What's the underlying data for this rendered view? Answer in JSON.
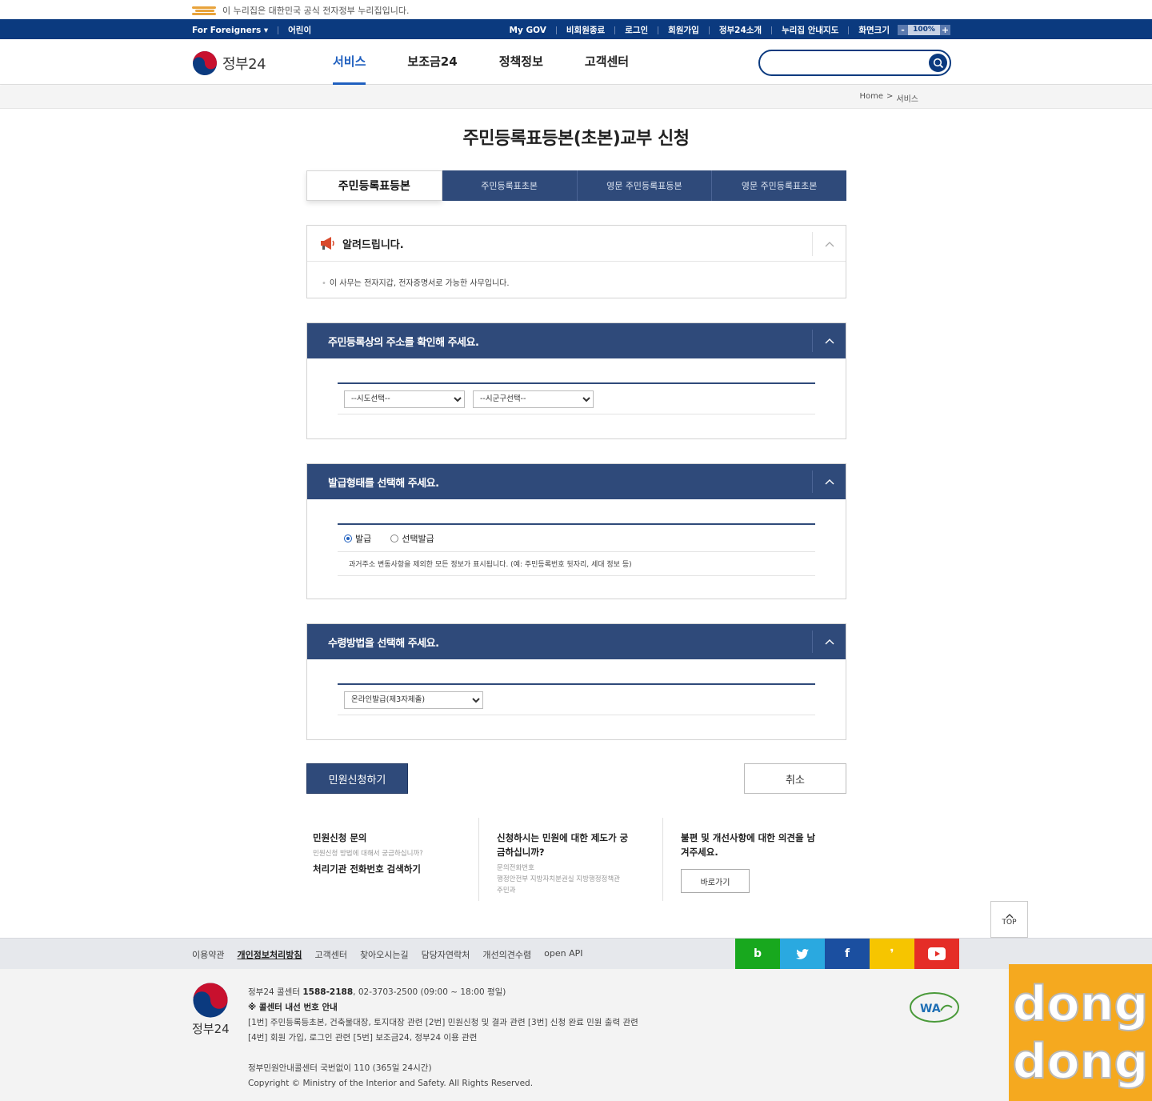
{
  "banner": {
    "text": "이 누리집은 대한민국 공식 전자정부 누리집입니다."
  },
  "util": {
    "left": [
      "For Foreigners ▾",
      "어린이"
    ],
    "right": [
      "My GOV",
      "비회원종료",
      "로그인",
      "회원가입",
      "정부24소개",
      "누리집 안내지도",
      "화면크기"
    ],
    "zoom_minus": "-",
    "zoom_value": "100%",
    "zoom_plus": "+"
  },
  "header": {
    "logo_text": "정부24",
    "nav": [
      "서비스",
      "보조금24",
      "정책정보",
      "고객센터"
    ],
    "search_placeholder": ""
  },
  "breadcrumb": [
    "Home",
    ">",
    "서비스"
  ],
  "page_title": "주민등록표등본(초본)교부 신청",
  "tabs": [
    "주민등록표등본",
    "주민등록표초본",
    "영문 주민등록표등본",
    "영문 주민등록표초본"
  ],
  "notice": {
    "title": "알려드립니다.",
    "body": "이 사무는 전자지갑, 전자증명서로 가능한 사무입니다."
  },
  "sections": {
    "address": {
      "title": "주민등록상의 주소를 확인해 주세요.",
      "sido": "--시도선택--",
      "sigungu": "--시군구선택--"
    },
    "issue": {
      "title": "발급형태를 선택해 주세요.",
      "options": [
        "발급",
        "선택발급"
      ],
      "desc": "과거주소 변동사항을 제외한 모든 정보가 표시됩니다. (예: 주민등록번호 뒷자리, 세대 정보 등)"
    },
    "receive": {
      "title": "수령방법을 선택해 주세요.",
      "method": "온라인발급(제3자제출)"
    }
  },
  "buttons": {
    "submit": "민원신청하기",
    "cancel": "취소"
  },
  "info": {
    "col1": {
      "title": "민원신청 문의",
      "sub": "민원신청 방법에 대해서 궁금하십니까?",
      "link": "처리기관 전화번호 검색하기"
    },
    "col2": {
      "title1": "신청하시는 민원에 대한 제도가 궁",
      "title2": "금하십니까?",
      "sub1": "문의전화번호",
      "sub2": "행정안전부 지방자치분권실 지방행정정책관",
      "sub3": "주민과"
    },
    "col3": {
      "title1": "불편 및 개선사항에 대한 의견을 남",
      "title2": "겨주세요.",
      "button": "바로가기"
    }
  },
  "top_button": "TOP",
  "footer_links": [
    "이용약관",
    "개인정보처리방침",
    "고객센터",
    "찾아오시는길",
    "담당자연락처",
    "개선의견수렴",
    "open API"
  ],
  "sns": [
    {
      "name": "blog",
      "glyph": "b",
      "color": "#18a81e"
    },
    {
      "name": "twitter",
      "glyph": "🐦",
      "color": "#2aa9e0"
    },
    {
      "name": "facebook",
      "glyph": "f",
      "color": "#1b4fa0"
    },
    {
      "name": "kakao",
      "glyph": "❜",
      "color": "#f6c500"
    },
    {
      "name": "youtube",
      "glyph": "▶",
      "color": "#e52d27"
    }
  ],
  "footer": {
    "logo_text": "정부24",
    "line1_pre": "정부24 콜센터 ",
    "line1_num": "1588-2188",
    "line1_post": ", 02-3703-2500 (09:00 ~ 18:00 평일)",
    "line2": "※ 콜센터 내선 번호 안내",
    "line3": "[1번] 주민등록등초본, 건축물대장, 토지대장 관련 [2번] 민원신청 및 결과 관련 [3번] 신청 완료 민원 출력 관련",
    "line4": "[4번] 회원 가입, 로그인 관련 [5번] 보조금24, 정부24 이용 관련",
    "line5": "정부민원안내콜센터 국번없이 110 (365일 24시간)",
    "line6": "Copyright © Ministry of the Interior and Safety. All Rights Reserved."
  },
  "watermark": [
    "dong",
    "dong"
  ],
  "colors": {
    "navy": "#0b3a7f",
    "section": "#2f4a7a",
    "accent": "#1f5fbf"
  }
}
